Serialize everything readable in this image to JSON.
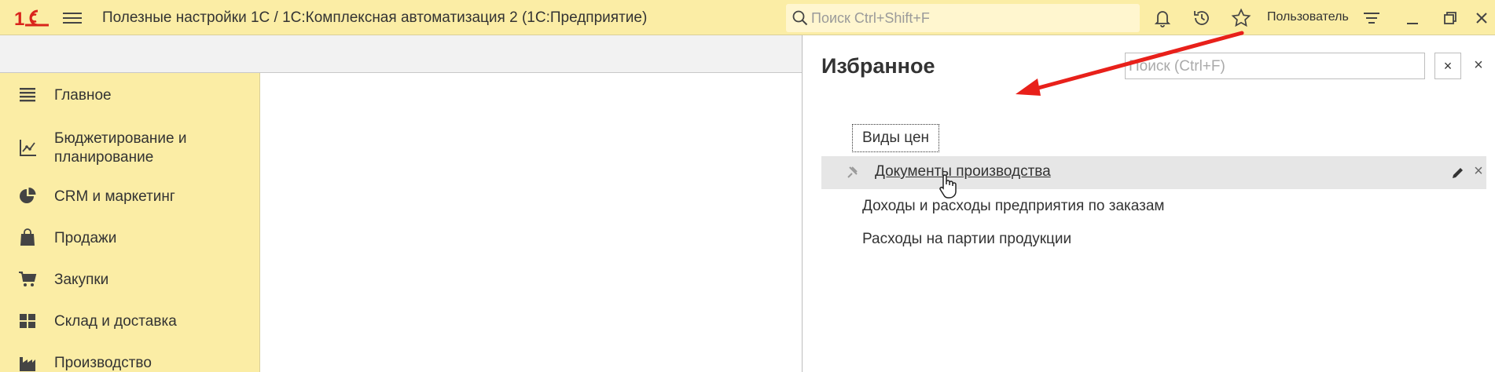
{
  "app": {
    "title": "Полезные настройки 1С / 1С:Комплексная автоматизация 2  (1С:Предприятие)",
    "logo": "1С",
    "search_placeholder": "Поиск Ctrl+Shift+F",
    "user_label": "Пользователь",
    "accent_color": "#fbeda5",
    "logo_color": "#d9241c"
  },
  "sidebar": {
    "items": [
      {
        "label": "Главное",
        "icon": "list-icon"
      },
      {
        "label": "Бюджетирование и планирование",
        "icon": "chart-axes-icon"
      },
      {
        "label": "CRM и маркетинг",
        "icon": "pie-chart-icon"
      },
      {
        "label": "Продажи",
        "icon": "shopping-bag-icon"
      },
      {
        "label": "Закупки",
        "icon": "cart-icon"
      },
      {
        "label": "Склад и доставка",
        "icon": "warehouse-grid-icon"
      },
      {
        "label": "Производство",
        "icon": "factory-icon"
      }
    ]
  },
  "favorites": {
    "title": "Избранное",
    "search_placeholder": "Поиск (Ctrl+F)",
    "items": [
      {
        "label": "Виды цен"
      },
      {
        "label": "Документы производства"
      },
      {
        "label": "Доходы и расходы предприятия по заказам"
      },
      {
        "label": "Расходы на партии продукции"
      }
    ]
  },
  "annotation": {
    "arrow_color": "#e8201a"
  }
}
